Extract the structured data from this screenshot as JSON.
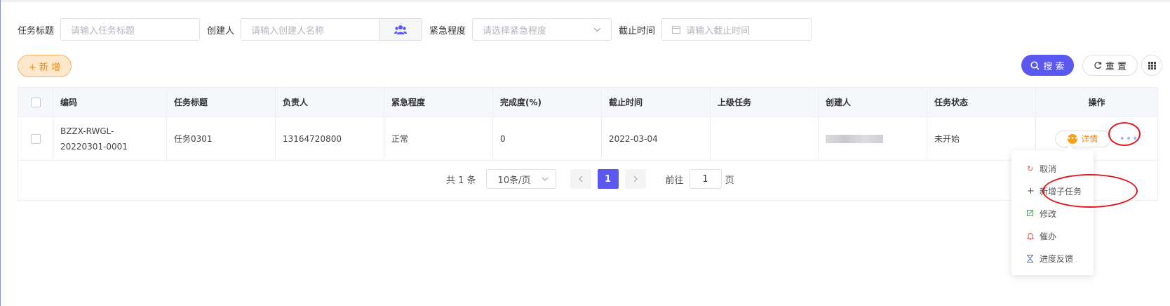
{
  "search_form": {
    "title_label": "任务标题",
    "title_placeholder": "请输入任务标题",
    "creator_label": "创建人",
    "creator_placeholder": "请输入创建人名称",
    "urgency_label": "紧急程度",
    "urgency_placeholder": "请选择紧急程度",
    "deadline_label": "截止时间",
    "deadline_placeholder": "请输入截止时间"
  },
  "toolbar": {
    "add_label": "+ 新 增",
    "search_label": "搜 索",
    "reset_label": "重 置"
  },
  "table": {
    "columns": [
      "编码",
      "任务标题",
      "负责人",
      "紧急程度",
      "完成度(%)",
      "截止时间",
      "上级任务",
      "创建人",
      "任务状态",
      "操作"
    ],
    "rows": [
      {
        "code": "BZZX-RWGL-20220301-0001",
        "title": "任务0301",
        "owner": "13164720800",
        "urgency": "正常",
        "progress": "0",
        "deadline": "2022-03-04",
        "parent": "",
        "creator": "",
        "status": "未开始",
        "detail_label": "详情",
        "more_label": "•••"
      }
    ]
  },
  "pagination": {
    "total": "共 1 条",
    "page_size": "10条/页",
    "current_page": "1",
    "goto_label": "前往",
    "goto_value": "1",
    "page_suffix": "页"
  },
  "dropdown_menu": {
    "items": [
      {
        "label": "取消",
        "icon": "cancel-icon",
        "color": "#e8625a"
      },
      {
        "label": "新增子任务",
        "icon": "plus-icon",
        "color": "#555555"
      },
      {
        "label": "修改",
        "icon": "edit-icon",
        "color": "#3fae52"
      },
      {
        "label": "催办",
        "icon": "bell-icon",
        "color": "#e04848"
      },
      {
        "label": "进度反馈",
        "icon": "hourglass-icon",
        "color": "#4a6ad8"
      }
    ]
  },
  "colors": {
    "primary": "#5a58ee",
    "warning": "#f08a1a",
    "annotation": "#e0191e"
  }
}
